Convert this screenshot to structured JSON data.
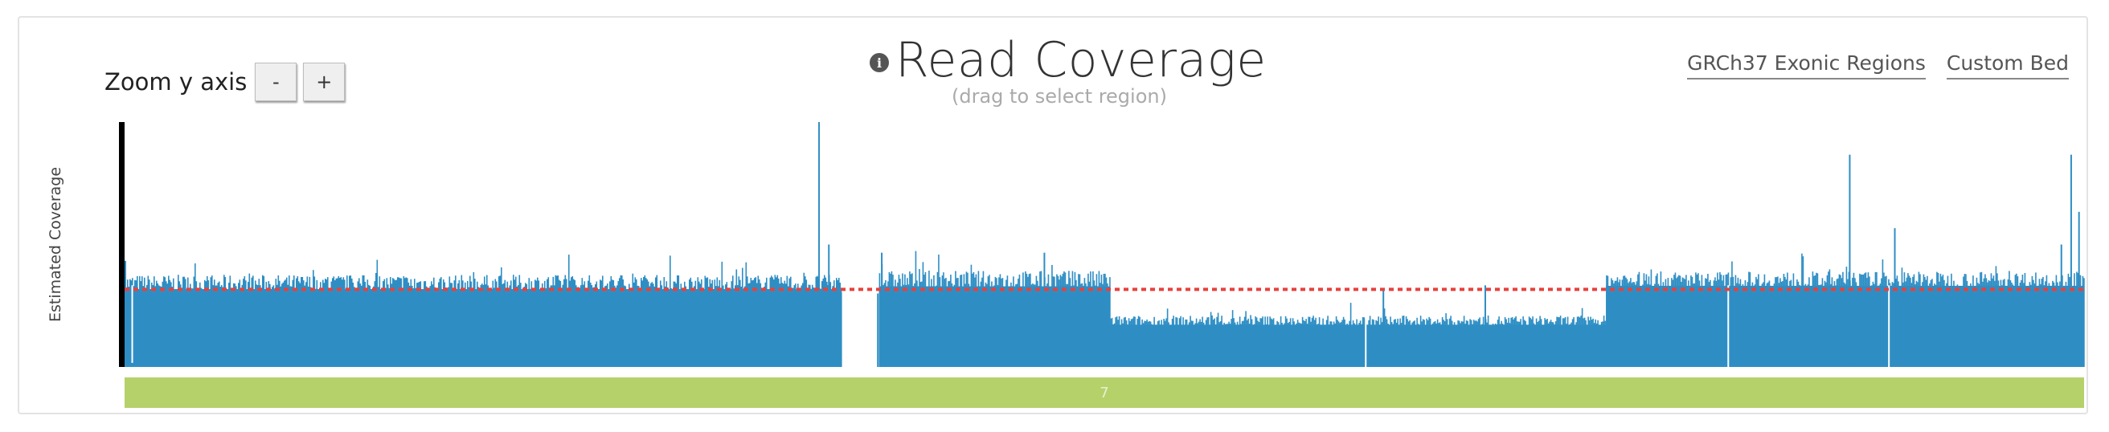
{
  "zoom": {
    "label": "Zoom y axis",
    "minus": "-",
    "plus": "+"
  },
  "header": {
    "info_icon": "info-icon",
    "title": "Read Coverage",
    "subtitle": "(drag to select region)"
  },
  "links": {
    "exonic": "GRCh37 Exonic Regions",
    "custom": "Custom Bed"
  },
  "colors": {
    "bar": "#2e8ec4",
    "mean_line": "#e8413c",
    "chromosome": "#b5d16a",
    "axis": "#000000"
  },
  "chart_data": {
    "type": "bar",
    "ylabel": "Estimated Coverage",
    "ylim": [
      0,
      30
    ],
    "yticks": [
      "0x",
      "5x",
      "10x",
      "15x",
      "20x",
      "25x",
      "30x"
    ],
    "mean_coverage": 9.5,
    "chromosome_label": "7",
    "segments": [
      {
        "x_start": 0.0,
        "x_end": 0.366,
        "base": 10.2,
        "jitter": 1.1
      },
      {
        "x_start": 0.385,
        "x_end": 0.503,
        "base": 10.6,
        "jitter": 1.2
      },
      {
        "x_start": 0.503,
        "x_end": 0.756,
        "base": 5.6,
        "jitter": 0.7
      },
      {
        "x_start": 0.756,
        "x_end": 1.0,
        "base": 10.6,
        "jitter": 1.1
      }
    ],
    "gap": [
      0.366,
      0.385
    ],
    "peaks": [
      {
        "x": 0.0,
        "y": 13.0
      },
      {
        "x": 0.003,
        "y": 5.0
      },
      {
        "x": 0.354,
        "y": 30.0
      },
      {
        "x": 0.359,
        "y": 15.0
      },
      {
        "x": 0.384,
        "y": 9.0
      },
      {
        "x": 0.386,
        "y": 14.0
      },
      {
        "x": 0.469,
        "y": 14.0
      },
      {
        "x": 0.642,
        "y": 9.5
      },
      {
        "x": 0.694,
        "y": 10.0
      },
      {
        "x": 0.88,
        "y": 26.0
      },
      {
        "x": 0.903,
        "y": 17.0
      },
      {
        "x": 0.988,
        "y": 15.0
      },
      {
        "x": 0.993,
        "y": 26.0
      },
      {
        "x": 0.997,
        "y": 19.0
      }
    ],
    "dips": [
      {
        "x": 0.0035,
        "y": 0.5
      },
      {
        "x": 0.633,
        "y": 0.0
      },
      {
        "x": 0.818,
        "y": 0.0
      },
      {
        "x": 0.9,
        "y": 0.0
      }
    ]
  }
}
